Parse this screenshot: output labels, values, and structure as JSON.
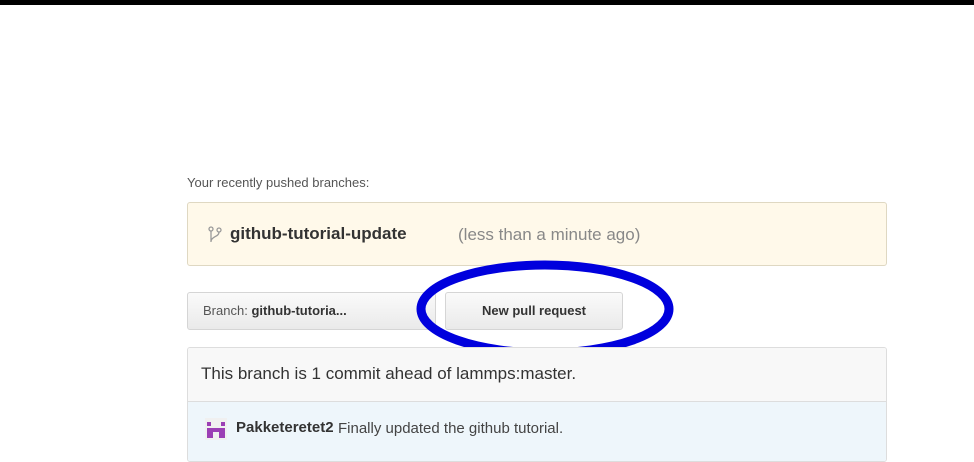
{
  "recent": {
    "label": "Your recently pushed branches:",
    "branch": "github-tutorial-update",
    "time": "(less than a minute ago)",
    "icon": "branch-icon"
  },
  "toolbar": {
    "branch_prefix": "Branch:",
    "branch_name": "github-tutoria...",
    "pull_request_label": "New pull request"
  },
  "compare": {
    "ahead_text": "This branch is 1 commit ahead of lammps:master.",
    "commit": {
      "author": "Pakketeretet2",
      "message": "Finally updated the github tutorial.",
      "avatar_icon": "identicon-avatar"
    }
  },
  "annotation": {
    "color": "#0000dd"
  }
}
